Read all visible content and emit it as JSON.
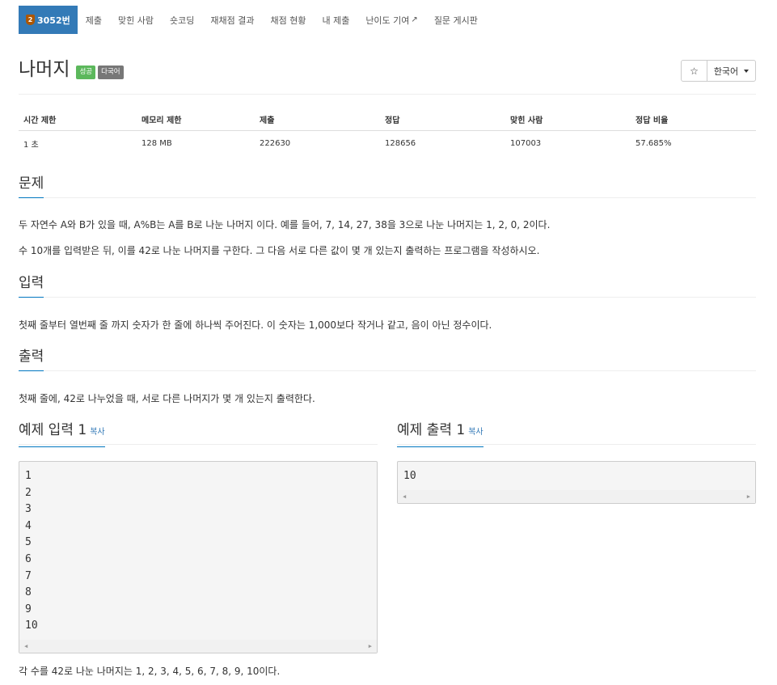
{
  "nav": {
    "items": [
      {
        "label": "3052번",
        "tier": "2",
        "active": true
      },
      {
        "label": "제출"
      },
      {
        "label": "맞힌 사람"
      },
      {
        "label": "숏코딩"
      },
      {
        "label": "재채점 결과"
      },
      {
        "label": "채점 현황"
      },
      {
        "label": "내 제출"
      },
      {
        "label": "난이도 기여",
        "external": true
      },
      {
        "label": "질문 게시판"
      }
    ]
  },
  "problem": {
    "title": "나머지",
    "labels": [
      "성공",
      "다국어"
    ],
    "language": "한국어"
  },
  "info": {
    "headers": [
      "시간 제한",
      "메모리 제한",
      "제출",
      "정답",
      "맞힌 사람",
      "정답 비율"
    ],
    "values": [
      "1 초",
      "128 MB",
      "222630",
      "128656",
      "107003",
      "57.685%"
    ]
  },
  "sections": {
    "problem_title": "문제",
    "problem_text": [
      "두 자연수 A와 B가 있을 때, A%B는 A를 B로 나눈 나머지 이다. 예를 들어, 7, 14, 27, 38을 3으로 나눈 나머지는 1, 2, 0, 2이다.",
      "수 10개를 입력받은 뒤, 이를 42로 나눈 나머지를 구한다. 그 다음 서로 다른 값이 몇 개 있는지 출력하는 프로그램을 작성하시오."
    ],
    "input_title": "입력",
    "input_text": "첫째 줄부터 열번째 줄 까지 숫자가 한 줄에 하나씩 주어진다. 이 숫자는 1,000보다 작거나 같고, 음이 아닌 정수이다.",
    "output_title": "출력",
    "output_text": "첫째 줄에, 42로 나누었을 때, 서로 다른 나머지가 몇 개 있는지 출력한다."
  },
  "examples": {
    "input_title": "예제 입력 1",
    "output_title": "예제 출력 1",
    "copy_label": "복사",
    "input_lines": [
      "1",
      "2",
      "3",
      "4",
      "5",
      "6",
      "7",
      "8",
      "9",
      "10"
    ],
    "output_lines": [
      "10"
    ],
    "note": "각 수를 42로 나눈 나머지는 1, 2, 3, 4, 5, 6, 7, 8, 9, 10이다."
  }
}
